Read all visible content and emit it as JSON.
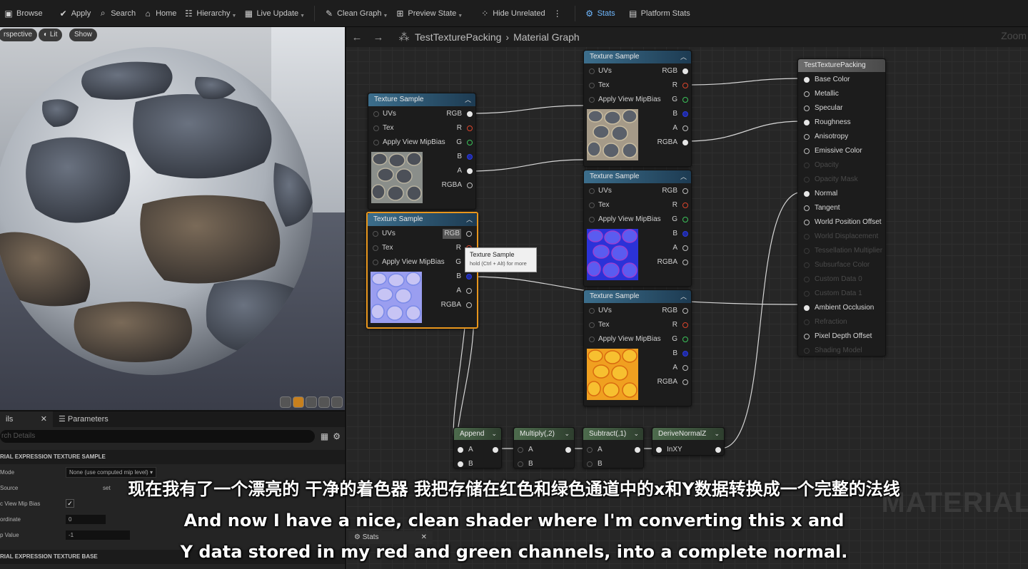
{
  "toolbar": {
    "items": [
      {
        "label": "Browse",
        "icon": "folder-icon"
      },
      {
        "label": "Apply",
        "icon": "apply-check-icon"
      },
      {
        "label": "Search",
        "icon": "search-icon"
      },
      {
        "label": "Home",
        "icon": "home-icon"
      },
      {
        "label": "Hierarchy",
        "icon": "hierarchy-icon"
      },
      {
        "label": "Live Update",
        "icon": "live-update-icon"
      },
      {
        "label": "Clean Graph",
        "icon": "broom-icon"
      },
      {
        "label": "Preview State",
        "icon": "preview-state-icon"
      },
      {
        "label": "Hide Unrelated",
        "icon": "hide-unrelated-icon"
      },
      {
        "label": "Stats",
        "icon": "stats-icon"
      },
      {
        "label": "Platform Stats",
        "icon": "platform-stats-icon"
      }
    ]
  },
  "viewport": {
    "perspective_label": "rspective",
    "lit_label": "Lit",
    "show_label": "Show"
  },
  "details": {
    "details_tab": "ils",
    "parameters_tab": "Parameters",
    "search_placeholder": "rch Details",
    "category_sample": "RIAL EXPRESSION TEXTURE SAMPLE",
    "category_base": "RIAL EXPRESSION TEXTURE BASE",
    "props": [
      {
        "label": "Mode",
        "value": "None (use computed mip level)"
      },
      {
        "label": "Source",
        "value": "set"
      },
      {
        "label": "c View Mip Bias",
        "value": "✓"
      },
      {
        "label": "ordinate",
        "value": "0"
      },
      {
        "label": "p Value",
        "value": "-1"
      }
    ],
    "stats_tab": "Stats"
  },
  "graph": {
    "asset_name": "TestTexturePacking",
    "graph_name": "Material Graph",
    "zoom_label": "Zoom",
    "watermark": "MATERIAL"
  },
  "nodes": {
    "texture_sample_title": "Texture Sample",
    "pin_uvs": "UVs",
    "pin_tex": "Tex",
    "pin_mip": "Apply View MipBias",
    "pin_rgb": "RGB",
    "pin_r": "R",
    "pin_g": "G",
    "pin_b": "B",
    "pin_a": "A",
    "pin_rgba": "RGBA",
    "append": "Append",
    "multiply": "Multiply(,2)",
    "subtract": "Subtract(,1)",
    "derive": "DeriveNormalZ",
    "pin_in_a": "A",
    "pin_in_b": "B",
    "pin_inxy": "InXY"
  },
  "result_node": {
    "title": "TestTexturePacking",
    "outputs": [
      {
        "label": "Base Color",
        "enabled": true
      },
      {
        "label": "Metallic",
        "enabled": true
      },
      {
        "label": "Specular",
        "enabled": true
      },
      {
        "label": "Roughness",
        "enabled": true
      },
      {
        "label": "Anisotropy",
        "enabled": true
      },
      {
        "label": "Emissive Color",
        "enabled": true
      },
      {
        "label": "Opacity",
        "enabled": false
      },
      {
        "label": "Opacity Mask",
        "enabled": false
      },
      {
        "label": "Normal",
        "enabled": true
      },
      {
        "label": "Tangent",
        "enabled": true
      },
      {
        "label": "World Position Offset",
        "enabled": true
      },
      {
        "label": "World Displacement",
        "enabled": false
      },
      {
        "label": "Tessellation Multiplier",
        "enabled": false
      },
      {
        "label": "Subsurface Color",
        "enabled": false
      },
      {
        "label": "Custom Data 0",
        "enabled": false
      },
      {
        "label": "Custom Data 1",
        "enabled": false
      },
      {
        "label": "Ambient Occlusion",
        "enabled": true
      },
      {
        "label": "Refraction",
        "enabled": false
      },
      {
        "label": "Pixel Depth Offset",
        "enabled": true
      },
      {
        "label": "Shading Model",
        "enabled": false
      }
    ]
  },
  "tooltip": {
    "title": "Texture Sample",
    "hint": "hold (Ctrl + Alt) for more"
  },
  "subtitles": {
    "zh": "现在我有了一个漂亮的 干净的着色器 我把存储在红色和绿色通道中的x和Y数据转换成一个完整的法线",
    "en_line1": "And now I have a nice, clean shader where I'm converting this x and",
    "en_line2": "Y data stored in my red and green channels, into a complete normal."
  }
}
